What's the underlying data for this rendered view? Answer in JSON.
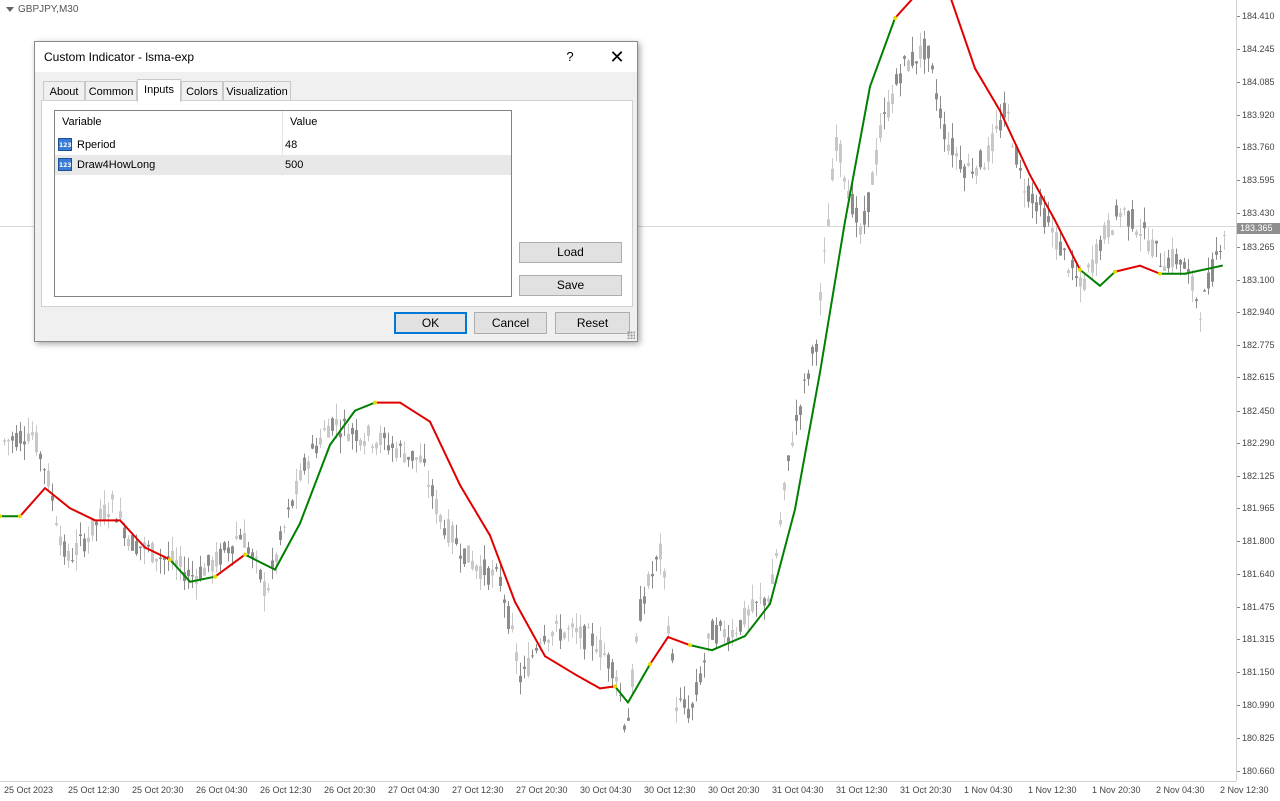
{
  "chart": {
    "symbol": "GBPJPY,M30",
    "current_price": "183.365",
    "price_min": 180.61,
    "price_max": 184.49,
    "price_labels": [
      "184.410",
      "184.245",
      "184.085",
      "183.920",
      "183.760",
      "183.595",
      "183.430",
      "183.265",
      "183.100",
      "182.940",
      "182.775",
      "182.615",
      "182.450",
      "182.290",
      "182.125",
      "181.965",
      "181.800",
      "181.640",
      "181.475",
      "181.315",
      "181.150",
      "180.990",
      "180.825",
      "180.660"
    ],
    "time_labels": [
      "25 Oct 2023",
      "25 Oct 12:30",
      "25 Oct 20:30",
      "26 Oct 04:30",
      "26 Oct 12:30",
      "26 Oct 20:30",
      "27 Oct 04:30",
      "27 Oct 12:30",
      "27 Oct 20:30",
      "30 Oct 04:30",
      "30 Oct 12:30",
      "30 Oct 20:30",
      "31 Oct 04:30",
      "31 Oct 12:30",
      "31 Oct 20:30",
      "1 Nov 04:30",
      "1 Nov 12:30",
      "1 Nov 20:30",
      "2 Nov 04:30",
      "2 Nov 12:30"
    ],
    "colors": {
      "up": "#008000",
      "down": "#e00000",
      "flat": "#e6d800",
      "candle": "#8c8c8c",
      "candle_light": "#c8c8c8"
    },
    "indicator_path": [
      [
        0,
        181.925,
        "d"
      ],
      [
        20,
        181.925,
        "u"
      ],
      [
        45,
        182.065,
        "d"
      ],
      [
        70,
        181.965,
        "d"
      ],
      [
        95,
        181.905,
        "d"
      ],
      [
        120,
        181.905,
        "d"
      ],
      [
        145,
        181.77,
        "d"
      ],
      [
        170,
        181.71,
        "d"
      ],
      [
        190,
        181.6,
        "u"
      ],
      [
        215,
        181.625,
        "u"
      ],
      [
        245,
        181.735,
        "d"
      ],
      [
        275,
        181.66,
        "u"
      ],
      [
        300,
        181.89,
        "u"
      ],
      [
        330,
        182.28,
        "u"
      ],
      [
        355,
        182.45,
        "u"
      ],
      [
        375,
        182.49,
        "u"
      ],
      [
        400,
        182.49,
        "d"
      ],
      [
        430,
        182.395,
        "d"
      ],
      [
        460,
        182.08,
        "d"
      ],
      [
        490,
        181.83,
        "d"
      ],
      [
        515,
        181.5,
        "d"
      ],
      [
        545,
        181.23,
        "d"
      ],
      [
        575,
        181.14,
        "d"
      ],
      [
        600,
        181.07,
        "d"
      ],
      [
        615,
        181.08,
        "d"
      ],
      [
        628,
        181.0,
        "u"
      ],
      [
        650,
        181.19,
        "u"
      ],
      [
        668,
        181.325,
        "d"
      ],
      [
        690,
        181.285,
        "d"
      ],
      [
        712,
        181.26,
        "u"
      ],
      [
        745,
        181.33,
        "u"
      ],
      [
        770,
        181.49,
        "u"
      ],
      [
        795,
        181.96,
        "u"
      ],
      [
        820,
        182.64,
        "u"
      ],
      [
        845,
        183.39,
        "u"
      ],
      [
        870,
        184.06,
        "u"
      ],
      [
        895,
        184.4,
        "u"
      ],
      [
        915,
        184.51,
        "d"
      ],
      [
        950,
        184.51,
        "d"
      ],
      [
        975,
        184.15,
        "d"
      ],
      [
        1000,
        183.94,
        "d"
      ],
      [
        1030,
        183.62,
        "d"
      ],
      [
        1055,
        183.395,
        "d"
      ],
      [
        1080,
        183.15,
        "d"
      ],
      [
        1100,
        183.07,
        "u"
      ],
      [
        1115,
        183.14,
        "u"
      ],
      [
        1140,
        183.17,
        "d"
      ],
      [
        1160,
        183.13,
        "d"
      ],
      [
        1185,
        183.13,
        "u"
      ],
      [
        1222,
        183.17,
        "u"
      ]
    ],
    "candle_pivots": [
      [
        0,
        182.29
      ],
      [
        30,
        182.35
      ],
      [
        45,
        182.15
      ],
      [
        65,
        181.7
      ],
      [
        90,
        181.85
      ],
      [
        110,
        182.0
      ],
      [
        130,
        181.8
      ],
      [
        150,
        181.75
      ],
      [
        170,
        181.7
      ],
      [
        190,
        181.63
      ],
      [
        215,
        181.7
      ],
      [
        240,
        181.85
      ],
      [
        265,
        181.55
      ],
      [
        285,
        181.9
      ],
      [
        305,
        182.2
      ],
      [
        330,
        182.4
      ],
      [
        350,
        182.35
      ],
      [
        380,
        182.3
      ],
      [
        400,
        182.25
      ],
      [
        420,
        182.2
      ],
      [
        440,
        181.9
      ],
      [
        470,
        181.7
      ],
      [
        500,
        181.6
      ],
      [
        520,
        181.1
      ],
      [
        540,
        181.35
      ],
      [
        570,
        181.35
      ],
      [
        595,
        181.3
      ],
      [
        615,
        181.15
      ],
      [
        625,
        180.85
      ],
      [
        640,
        181.5
      ],
      [
        660,
        181.75
      ],
      [
        675,
        181.0
      ],
      [
        690,
        180.95
      ],
      [
        710,
        181.35
      ],
      [
        730,
        181.35
      ],
      [
        750,
        181.45
      ],
      [
        770,
        181.55
      ],
      [
        790,
        182.3
      ],
      [
        815,
        182.8
      ],
      [
        835,
        183.8
      ],
      [
        860,
        183.3
      ],
      [
        880,
        183.85
      ],
      [
        900,
        184.15
      ],
      [
        925,
        184.25
      ],
      [
        945,
        183.8
      ],
      [
        965,
        183.65
      ],
      [
        985,
        183.7
      ],
      [
        1005,
        183.95
      ],
      [
        1020,
        183.6
      ],
      [
        1040,
        183.45
      ],
      [
        1060,
        183.25
      ],
      [
        1080,
        183.05
      ],
      [
        1100,
        183.3
      ],
      [
        1120,
        183.45
      ],
      [
        1140,
        183.35
      ],
      [
        1160,
        183.2
      ],
      [
        1180,
        183.2
      ],
      [
        1200,
        182.95
      ],
      [
        1222,
        183.35
      ]
    ],
    "vertical_line_time_index": 0,
    "horizontal_line_price": 183.365
  },
  "dialog": {
    "title": "Custom Indicator - lsma-exp",
    "help_label": "?",
    "close_label": "✕",
    "tabs": [
      {
        "label": "About",
        "active": false
      },
      {
        "label": "Common",
        "active": false
      },
      {
        "label": "Inputs",
        "active": true
      },
      {
        "label": "Colors",
        "active": false
      },
      {
        "label": "Visualization",
        "active": false
      }
    ],
    "table": {
      "headers": {
        "variable": "Variable",
        "value": "Value"
      },
      "rows": [
        {
          "icon": "numeric-type-icon",
          "icon_text": "123",
          "variable": "Rperiod",
          "value": "48",
          "selected": false
        },
        {
          "icon": "numeric-type-icon",
          "icon_text": "123",
          "variable": "Draw4HowLong",
          "value": "500",
          "selected": true
        }
      ]
    },
    "buttons": {
      "load": "Load",
      "save": "Save",
      "ok": "OK",
      "cancel": "Cancel",
      "reset": "Reset"
    }
  }
}
